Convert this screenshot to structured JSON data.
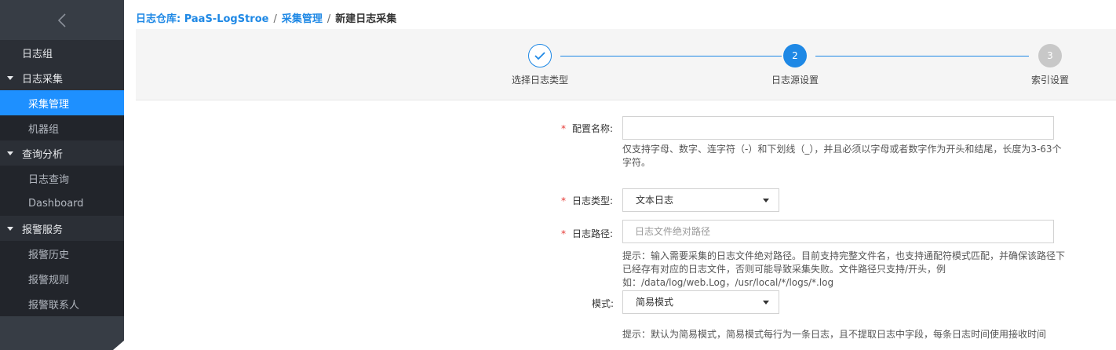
{
  "sidebar": {
    "collapse_icon": "chevron-left-icon",
    "items": [
      {
        "label": "日志组"
      },
      {
        "label": "日志采集",
        "children": [
          "采集管理",
          "机器组"
        ]
      },
      {
        "label": "查询分析",
        "children": [
          "日志查询",
          "Dashboard"
        ]
      },
      {
        "label": "报警服务",
        "children": [
          "报警历史",
          "报警规则",
          "报警联系人"
        ]
      }
    ],
    "active": "采集管理"
  },
  "breadcrumb": {
    "root": "日志仓库: PaaS-LogStroe",
    "parent": "采集管理",
    "current": "新建日志采集",
    "separator": "/"
  },
  "steps": [
    {
      "number": "1",
      "label": "选择日志类型",
      "status": "done"
    },
    {
      "number": "2",
      "label": "日志源设置",
      "status": "active"
    },
    {
      "number": "3",
      "label": "索引设置",
      "status": "wait"
    }
  ],
  "form": {
    "required_mark": "*",
    "config_name": {
      "label": "配置名称:",
      "value": "",
      "hint_line1": "仅支持字母、数字、连字符（-）和下划线（_），并且必须以字母或者数字作为开头和结尾，长度为3-63个",
      "hint_line2": "字符。"
    },
    "log_type": {
      "label": "日志类型:",
      "value": "文本日志"
    },
    "log_path": {
      "label": "日志路径:",
      "placeholder": "日志文件绝对路径",
      "hint_line1": "提示：输入需要采集的日志文件绝对路径。目前支持完整文件名，也支持通配符模式匹配，并确保该路径下",
      "hint_line2": "已经存有对应的日志文件，否则可能导致采集失败。文件路径只支持/开头，例",
      "hint_line3": "如：/data/log/web.Log，/usr/local/*/logs/*.log"
    },
    "mode": {
      "label": "模式:",
      "value": "简易模式",
      "hint": "提示：默认为简易模式，简易模式每行为一条日志，且不提取日志中字段，每条日志时间使用接收时间"
    }
  },
  "colors": {
    "accent": "#1e88e5",
    "sidebar_bg": "#22252b",
    "required": "#e53935"
  }
}
